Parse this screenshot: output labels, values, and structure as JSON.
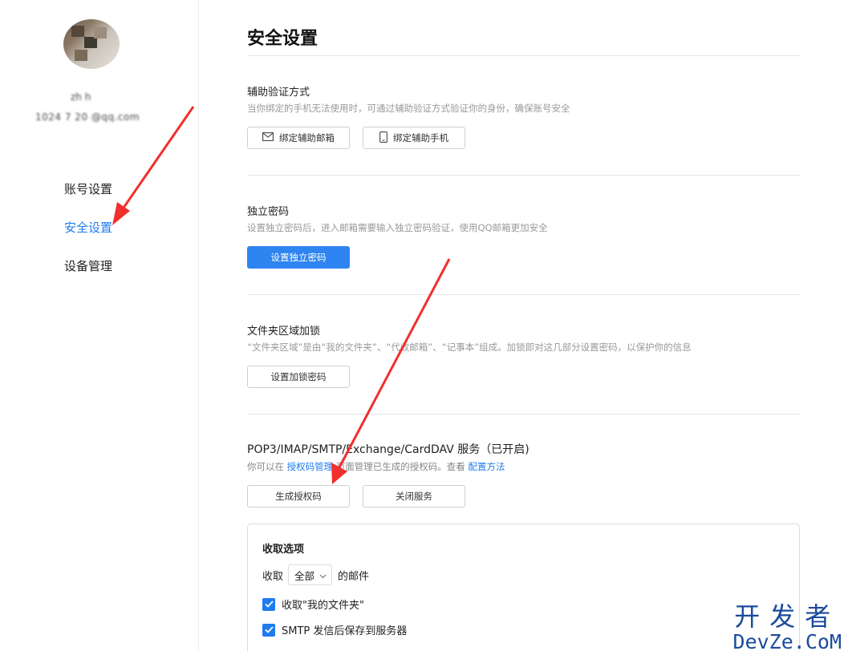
{
  "sidebar": {
    "user_name": "zh h",
    "user_email": "1024 7 20 @qq.com",
    "nav": [
      {
        "label": "账号设置",
        "active": false
      },
      {
        "label": "安全设置",
        "active": true
      },
      {
        "label": "设备管理",
        "active": false
      }
    ]
  },
  "page_title": "安全设置",
  "aux_verify": {
    "title": "辅助验证方式",
    "desc": "当你绑定的手机无法使用时，可通过辅助验证方式验证你的身份，确保账号安全",
    "bind_email_label": "绑定辅助邮箱",
    "bind_phone_label": "绑定辅助手机"
  },
  "independent_password": {
    "title": "独立密码",
    "desc": "设置独立密码后，进入邮箱需要输入独立密码验证，使用QQ邮箱更加安全",
    "button_label": "设置独立密码"
  },
  "folder_lock": {
    "title": "文件夹区域加锁",
    "desc": "“文件夹区域”是由“我的文件夹”、“代收邮箱”、“记事本”组成。加锁即对这几部分设置密码，以保护你的信息",
    "button_label": "设置加锁密码"
  },
  "pop3": {
    "title": "POP3/IMAP/SMTP/Exchange/CardDAV 服务（已开启)",
    "desc_prefix": "你可以在",
    "link_auth_manage": "授权码管理",
    "desc_middle": "页面管理已生成的授权码。查看",
    "link_config": "配置方法",
    "generate_label": "生成授权码",
    "close_label": "关闭服务"
  },
  "receive_options": {
    "title": "收取选项",
    "receive_prefix": "收取",
    "receive_scope": "全部",
    "receive_suffix": "的邮件",
    "checkbox1_label": "收取\"我的文件夹\"",
    "checkbox1_checked": true,
    "checkbox2_label": "SMTP 发信后保存到服务器",
    "checkbox2_checked": true
  },
  "watermark": {
    "line1": "开发者",
    "line2": "DevZe.CoM"
  },
  "colors": {
    "accent": "#1e7cf0",
    "primary_button": "#2e84f0",
    "annotation_arrow": "#f0302d"
  }
}
